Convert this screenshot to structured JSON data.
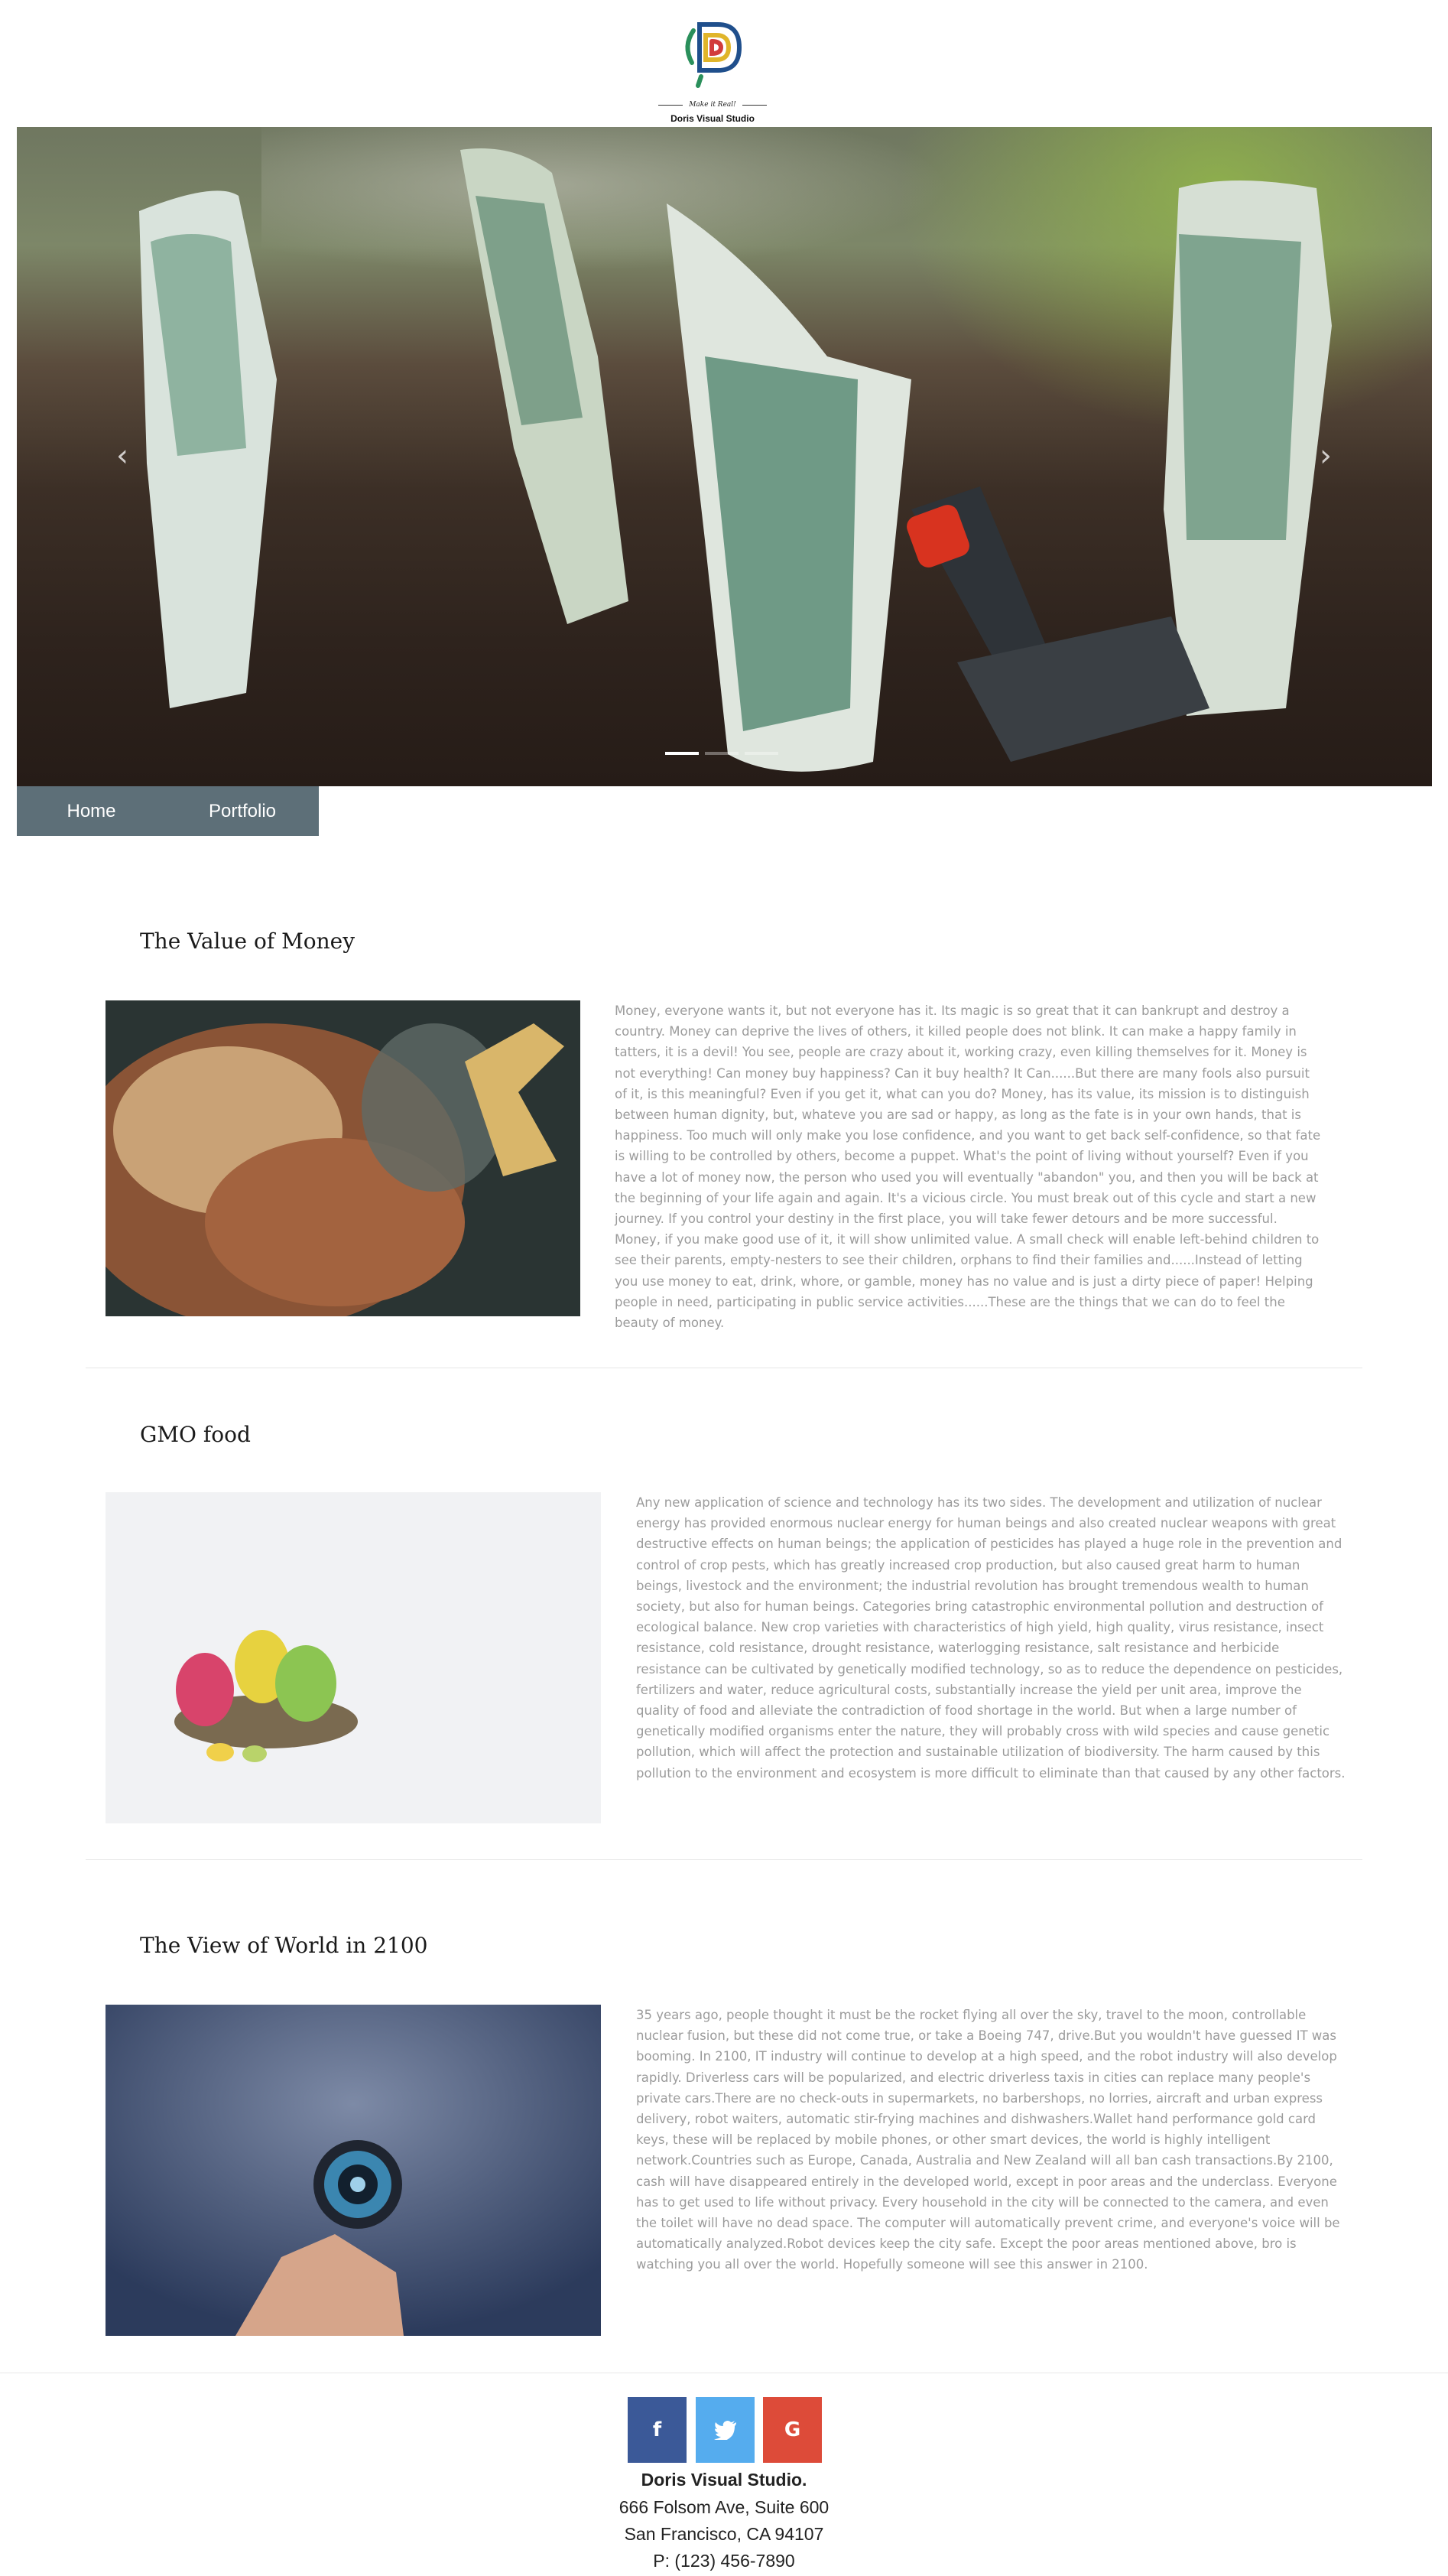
{
  "header": {
    "logo_tagline": "Make it Real!",
    "logo_name": "Doris Visual Studio"
  },
  "carousel": {
    "prev_icon": "chevron-left-icon",
    "next_icon": "chevron-right-icon",
    "prev_glyph": "‹",
    "next_glyph": "›",
    "slide_count": 3,
    "active_index": 0
  },
  "nav": {
    "items": [
      {
        "label": "Home"
      },
      {
        "label": "Portfolio"
      }
    ]
  },
  "articles": [
    {
      "title": "The Value of Money",
      "body": "Money, everyone wants it, but not everyone has it. Its magic is so great that it can bankrupt and destroy a country. Money can deprive the lives of others, it killed people does not blink. It can make a happy family in tatters, it is a devil! You see, people are crazy about it, working crazy, even killing themselves for it. Money is not everything! Can money buy happiness? Can it buy health? It Can......But there are many fools also pursuit of it, is this meaningful? Even if you get it, what can you do? Money, has its value, its mission is to distinguish between human dignity, but, whateve you are sad or happy, as long as the fate is in your own hands, that is happiness. Too much will only make you lose confidence, and you want to get back self-confidence, so that fate is willing to be controlled by others, become a puppet. What's the point of living without yourself? Even if you have a lot of money now, the person who used you will eventually \"abandon\" you, and then you will be back at the beginning of your life again and again. It's a vicious circle. You must break out of this cycle and start a new journey. If you control your destiny in the first place, you will take fewer detours and be more successful. Money, if you make good use of it, it will show unlimited value. A small check will enable left-behind children to see their parents, empty-nesters to see their children, orphans to find their families and......Instead of letting you use money to eat, drink, whore, or gamble, money has no value and is just a dirty piece of paper! Helping people in need, participating in public service activities......These are the things that we can do to feel the beauty of money."
    },
    {
      "title": "GMO food",
      "body": "Any new application of science and technology has its two sides. The development and utilization of nuclear energy has provided enormous nuclear energy for human beings and also created nuclear weapons with great destructive effects on human beings; the application of pesticides has played a huge role in the prevention and control of crop pests, which has greatly increased crop production, but also caused great harm to human beings, livestock and the environment; the industrial revolution has brought tremendous wealth to human society, but also for human beings. Categories bring catastrophic environmental pollution and destruction of ecological balance. New crop varieties with characteristics of high yield, high quality, virus resistance, insect resistance, cold resistance, drought resistance, waterlogging resistance, salt resistance and herbicide resistance can be cultivated by genetically modified technology, so as to reduce the dependence on pesticides, fertilizers and water, reduce agricultural costs, substantially increase the yield per unit area, improve the quality of food and alleviate the contradiction of food shortage in the world. But when a large number of genetically modified organisms enter the nature, they will probably cross with wild species and cause genetic pollution, which will affect the protection and sustainable utilization of biodiversity. The harm caused by this pollution to the environment and ecosystem is more difficult to eliminate than that caused by any other factors."
    },
    {
      "title": "The View of World in 2100",
      "body": "35 years ago, people thought it must be the rocket flying all over the sky, travel to the moon, controllable nuclear fusion, but these did not come true, or take a Boeing 747, drive.But you wouldn't have guessed IT was booming. In 2100, IT industry will continue to develop at a high speed, and the robot industry will also develop rapidly. Driverless cars will be popularized, and electric driverless taxis in cities can replace many people's private cars.There are no check-outs in supermarkets, no barbershops, no lorries, aircraft and urban express delivery, robot waiters, automatic stir-frying machines and dishwashers.Wallet hand performance gold card keys, these will be replaced by mobile phones, or other smart devices, the world is highly intelligent network.Countries such as Europe, Canada, Australia and New Zealand will all ban cash transactions.By 2100, cash will have disappeared entirely in the developed world, except in poor areas and the underclass. Everyone has to get used to life without privacy. Every household in the city will be connected to the camera, and even the toilet will have no dead space. The computer will automatically prevent crime, and everyone's voice will be automatically analyzed.Robot devices keep the city safe. Except the poor areas mentioned above, bro is watching you all over the world. Hopefully someone will see this answer in 2100."
    }
  ],
  "footer": {
    "social": [
      {
        "name": "facebook-icon",
        "glyph": "f",
        "color": "#3b5998"
      },
      {
        "name": "twitter-icon",
        "glyph": "t",
        "color": "#55acee"
      },
      {
        "name": "google-icon",
        "glyph": "G",
        "color": "#dd4b39"
      }
    ],
    "company": "Doris Visual Studio.",
    "address1": "666 Folsom Ave, Suite 600",
    "address2": "San Francisco, CA 94107",
    "phone": "P: (123) 456-7890"
  }
}
